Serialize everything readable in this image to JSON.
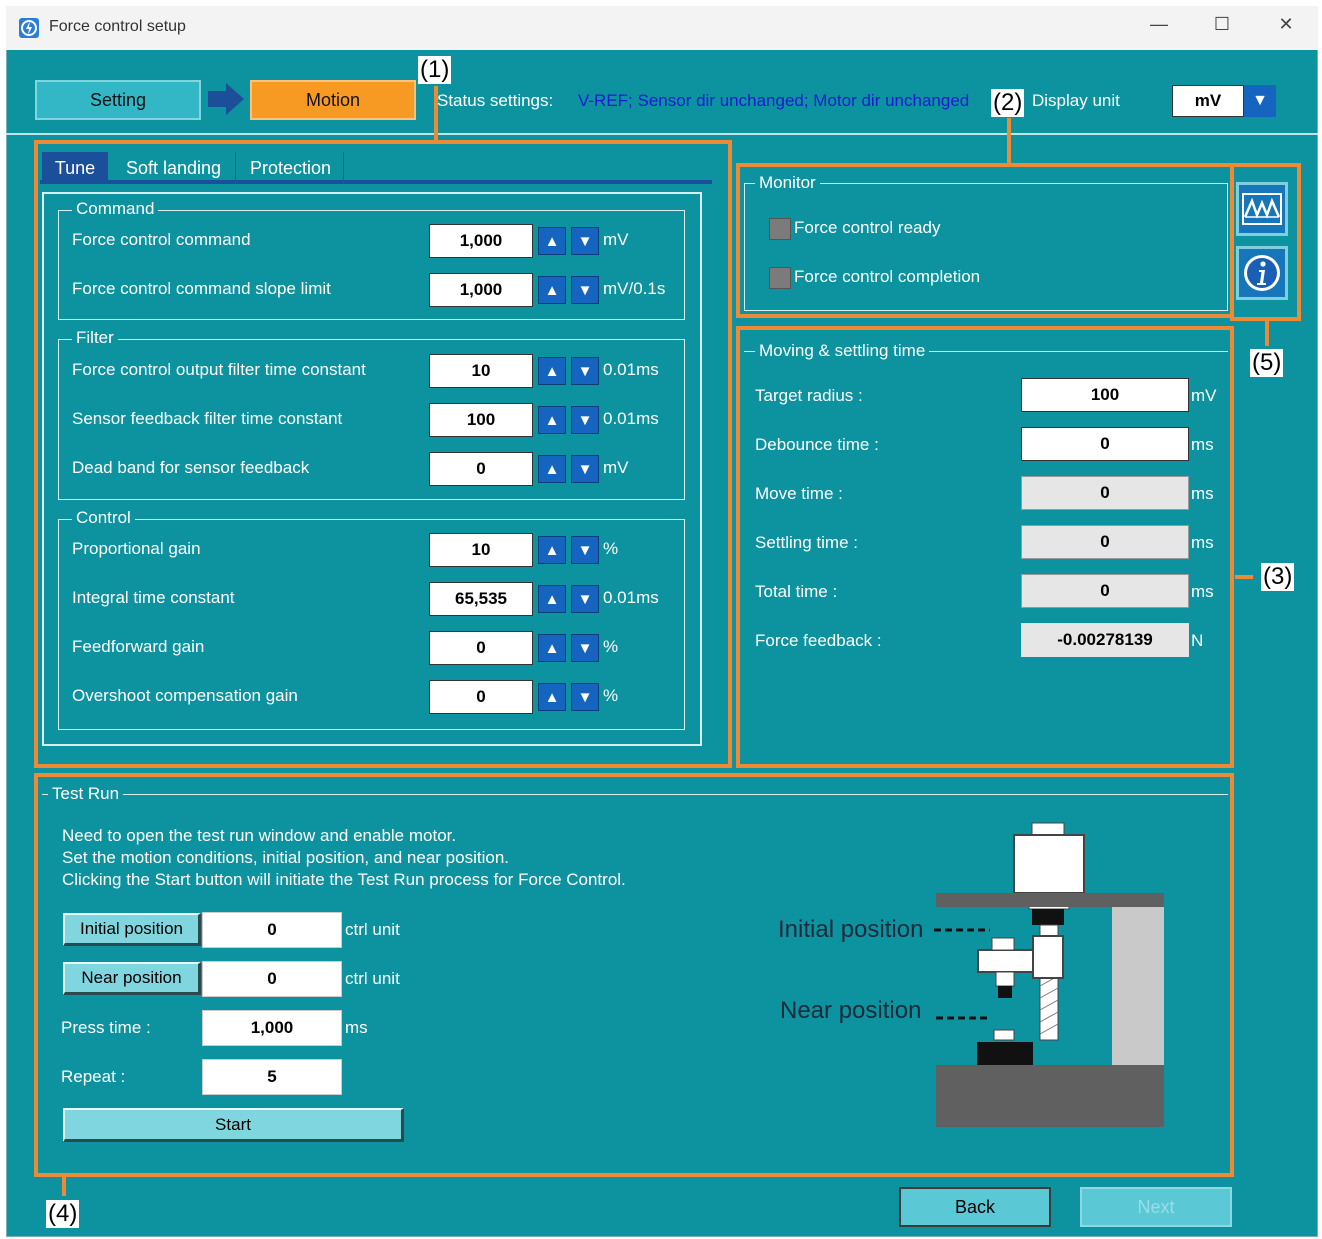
{
  "window": {
    "title": "Force control setup",
    "minimize": "—",
    "maximize": "☐",
    "close": "✕"
  },
  "header": {
    "step1": "Setting",
    "step2": "Motion",
    "status_label": "Status settings:",
    "status_value": "V-REF; Sensor dir unchanged; Motor dir unchanged",
    "display_unit_label": "Display unit",
    "display_unit_value": "mV"
  },
  "callouts": {
    "c1": "(1)",
    "c2": "(2)",
    "c3": "(3)",
    "c4": "(4)",
    "c5": "(5)"
  },
  "tabs": [
    "Tune",
    "Soft landing",
    "Protection"
  ],
  "command": {
    "title": "Command",
    "rows": [
      {
        "label": "Force control command",
        "value": "1,000",
        "unit": "mV"
      },
      {
        "label": "Force control command slope limit",
        "value": "1,000",
        "unit": "mV/0.1s"
      }
    ]
  },
  "filter": {
    "title": "Filter",
    "rows": [
      {
        "label": "Force control output filter time constant",
        "value": "10",
        "unit": "0.01ms"
      },
      {
        "label": "Sensor feedback filter time constant",
        "value": "100",
        "unit": "0.01ms"
      },
      {
        "label": "Dead band for sensor feedback",
        "value": "0",
        "unit": "mV"
      }
    ]
  },
  "control": {
    "title": "Control",
    "rows": [
      {
        "label": "Proportional gain",
        "value": "10",
        "unit": "%"
      },
      {
        "label": "Integral time constant",
        "value": "65,535",
        "unit": "0.01ms"
      },
      {
        "label": "Feedforward gain",
        "value": "0",
        "unit": "%"
      },
      {
        "label": "Overshoot compensation gain",
        "value": "0",
        "unit": "%"
      }
    ]
  },
  "monitor": {
    "title": "Monitor",
    "items": [
      "Force control ready",
      "Force control completion"
    ]
  },
  "moving": {
    "title": "Moving & settling time",
    "rows": [
      {
        "label": "Target radius :",
        "value": "100",
        "unit": "mV"
      },
      {
        "label": "Debounce time :",
        "value": "0",
        "unit": "ms"
      },
      {
        "label": "Move time :",
        "value": "0",
        "unit": "ms"
      },
      {
        "label": "Settling time :",
        "value": "0",
        "unit": "ms"
      },
      {
        "label": "Total time :",
        "value": "0",
        "unit": "ms"
      },
      {
        "label": "Force feedback :",
        "value": "-0.00278139",
        "unit": "N"
      }
    ]
  },
  "testrun": {
    "title": "Test Run",
    "desc1": "Need to open the test run window and enable motor.",
    "desc2": "Set the motion conditions, initial position, and near position.",
    "desc3": "Clicking the Start button will initiate the Test Run process for Force Control.",
    "initial_btn": "Initial position",
    "initial_value": "0",
    "near_btn": "Near position",
    "near_value": "0",
    "ctrl_unit": "ctrl unit",
    "press_label": "Press time :",
    "press_value": "1,000",
    "press_unit": "ms",
    "repeat_label": "Repeat :",
    "repeat_value": "5",
    "start": "Start",
    "diag_initial": "Initial position",
    "diag_near": "Near position"
  },
  "footer": {
    "back": "Back",
    "next": "Next"
  }
}
